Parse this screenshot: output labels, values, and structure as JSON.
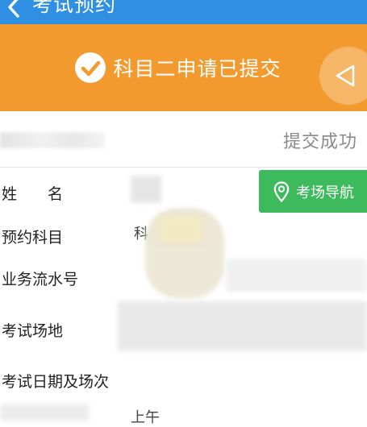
{
  "header": {
    "back_icon": "chevron-left-icon",
    "title": "考试预约"
  },
  "banner": {
    "icon": "check-circle-icon",
    "message": "科目二申请已提交",
    "side_icon": "triangle-left-icon"
  },
  "status": {
    "text": "提交成功"
  },
  "fields": {
    "name_label": "姓　　名",
    "subject_label": "预约科目",
    "serial_label": "业务流水号",
    "venue_label": "考试场地",
    "date_label": "考试日期及场次",
    "subject_value_partial": "科",
    "session_value_partial": "上午"
  },
  "navigation_button": {
    "icon": "location-pin-icon",
    "label": "考场导航"
  },
  "colors": {
    "header": "#2f8fe2",
    "banner": "#f29a2e",
    "nav_button": "#3dbb5c"
  }
}
